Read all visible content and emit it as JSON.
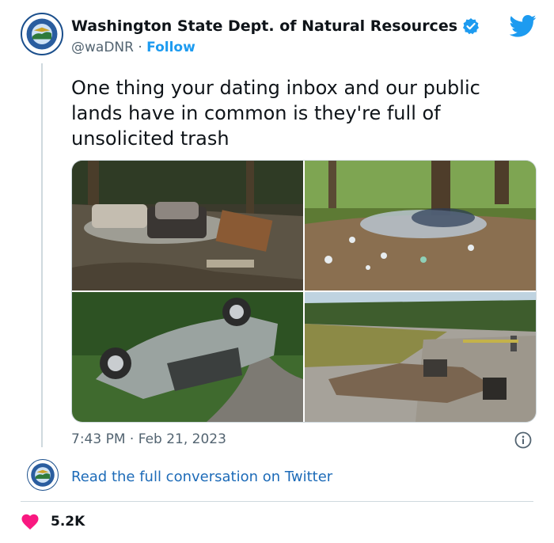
{
  "account": {
    "name": "Washington State Dept. of Natural Resources",
    "handle": "@waDNR",
    "separator": "·",
    "follow_label": "Follow",
    "verified_icon": "verified-badge-icon",
    "logo_icon": "dnr-seal-logo",
    "logo_text": "WASHINGTON NATURAL RESOURCES"
  },
  "tweet": {
    "text": "One thing your dating inbox and our public lands have in common is they're full of unsolicited trash",
    "time": "7:43 PM",
    "date_separator": "·",
    "date": "Feb 21, 2023",
    "photos": [
      {
        "name": "photo-dumped-couches"
      },
      {
        "name": "photo-forest-litter"
      },
      {
        "name": "photo-overturned-car"
      },
      {
        "name": "photo-roadside-dump"
      }
    ]
  },
  "footer": {
    "read_more_label": "Read the full conversation on Twitter",
    "like_count": "5.2K"
  },
  "colors": {
    "accent": "#1d9bf0",
    "link": "#1d6bb8",
    "heart": "#f91880",
    "muted_text": "#536471",
    "border": "#cfd9de"
  }
}
